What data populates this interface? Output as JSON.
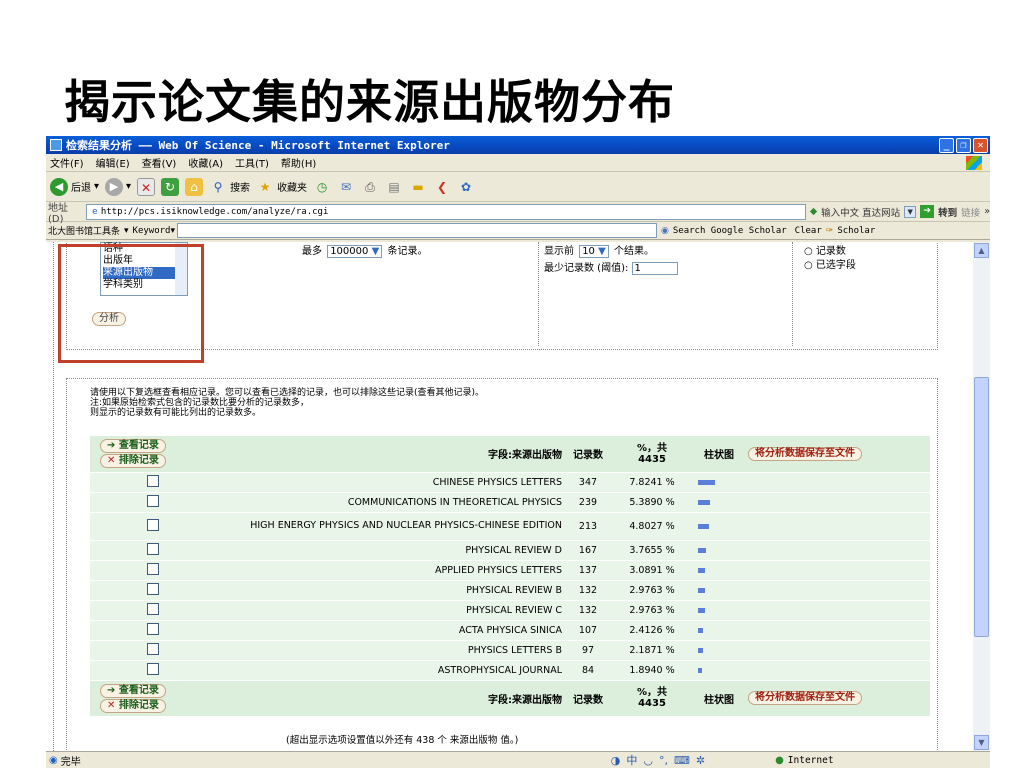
{
  "slide": {
    "title": "揭示论文集的来源出版物分布"
  },
  "window": {
    "title": "检索结果分析 —— Web Of Science - Microsoft Internet Explorer",
    "menu": [
      "文件(F)",
      "编辑(E)",
      "查看(V)",
      "收藏(A)",
      "工具(T)",
      "帮助(H)"
    ],
    "toolbar": {
      "back": "后退",
      "search": "搜索",
      "favorites": "收藏夹"
    },
    "address": {
      "label": "地址(D)",
      "url": "http://pcs.isiknowledge.com/analyze/ra.cgi",
      "input_hint": "输入中文 直达网站",
      "go": "转到",
      "links": "链接"
    },
    "searchbar": {
      "brand": "北大图书馆工具条",
      "keyword": "Keyword",
      "scholar_search": "Search Google Scholar",
      "clear": "Clear",
      "scholar": "Scholar"
    },
    "status": {
      "done": "完毕",
      "zone": "Internet"
    }
  },
  "form": {
    "listbox_items": [
      "语种",
      "出版年",
      "来源出版物",
      "学科类别"
    ],
    "listbox_selected": 2,
    "max_label_pre": "最多",
    "max_value": "100000",
    "max_label_post": "条记录。",
    "show_label_pre": "显示前",
    "show_value": "10",
    "show_label_post": "个结果。",
    "min_label": "最少记录数 (阈值):",
    "min_value": "1",
    "sort_opt1": "记录数",
    "sort_opt2": "已选字段",
    "analyze_button": "分析"
  },
  "instructions": [
    "请使用以下复选框查看相应记录。您可以查看已选择的记录，也可以排除这些记录(查看其他记录)。",
    "注:如果原始检索式包含的记录数比要分析的记录数多，",
    "则显示的记录数有可能比列出的记录数多。"
  ],
  "table": {
    "view_button": "查看记录",
    "exclude_button": "排除记录",
    "field_header": "字段:来源出版物",
    "count_header": "记录数",
    "pct_header": "%，共",
    "total": "4435",
    "bar_header": "柱状图",
    "save_button": "将分析数据保存至文件",
    "rows": [
      {
        "name": "CHINESE PHYSICS LETTERS",
        "count": "347",
        "pct": "7.8241 %",
        "pct_value": 7.8241
      },
      {
        "name": "COMMUNICATIONS IN THEORETICAL PHYSICS",
        "count": "239",
        "pct": "5.3890 %",
        "pct_value": 5.389
      },
      {
        "name": "HIGH ENERGY PHYSICS AND NUCLEAR PHYSICS-CHINESE EDITION",
        "count": "213",
        "pct": "4.8027 %",
        "pct_value": 4.8027
      },
      {
        "name": "PHYSICAL REVIEW D",
        "count": "167",
        "pct": "3.7655 %",
        "pct_value": 3.7655
      },
      {
        "name": "APPLIED PHYSICS LETTERS",
        "count": "137",
        "pct": "3.0891 %",
        "pct_value": 3.0891
      },
      {
        "name": "PHYSICAL REVIEW B",
        "count": "132",
        "pct": "2.9763 %",
        "pct_value": 2.9763
      },
      {
        "name": "PHYSICAL REVIEW C",
        "count": "132",
        "pct": "2.9763 %",
        "pct_value": 2.9763
      },
      {
        "name": "ACTA PHYSICA SINICA",
        "count": "107",
        "pct": "2.4126 %",
        "pct_value": 2.4126
      },
      {
        "name": "PHYSICS LETTERS B",
        "count": "97",
        "pct": "2.1871 %",
        "pct_value": 2.1871
      },
      {
        "name": "ASTROPHYSICAL JOURNAL",
        "count": "84",
        "pct": "1.8940 %",
        "pct_value": 1.894
      }
    ],
    "footer_note": "(超出显示选项设置值以外还有 438 个 来源出版物 值。)"
  }
}
